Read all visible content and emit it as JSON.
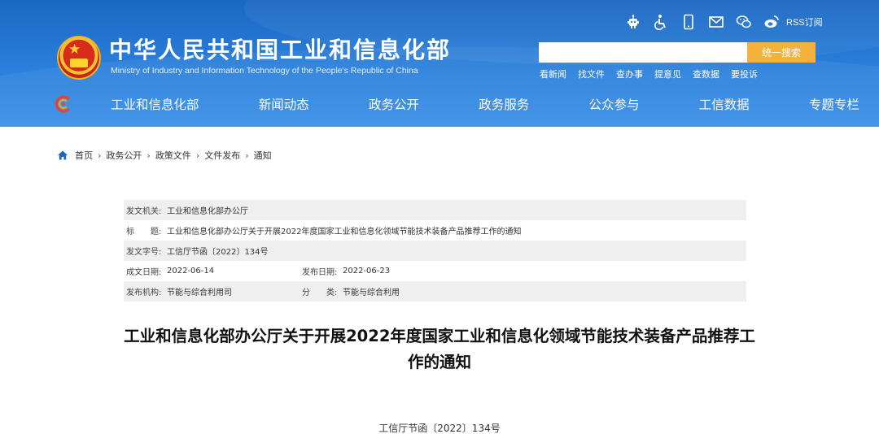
{
  "header": {
    "site_title": "中华人民共和国工业和信息化部",
    "site_subtitle": "Ministry of Industry and Information Technology of the People's Republic of China",
    "icons": [
      "robot-icon",
      "accessibility-icon",
      "mobile-icon",
      "mail-icon",
      "wechat-icon",
      "weibo-icon"
    ],
    "rss_label": "RSS订阅",
    "search": {
      "placeholder": "",
      "button_label": "统一搜索"
    },
    "quick_links": [
      "看新闻",
      "找文件",
      "查办事",
      "提意见",
      "查数据",
      "要投诉"
    ],
    "nav": [
      "工业和信息化部",
      "新闻动态",
      "政务公开",
      "政务服务",
      "公众参与",
      "工信数据",
      "专题专栏"
    ]
  },
  "breadcrumb": [
    "首页",
    "政务公开",
    "政策文件",
    "文件发布",
    "通知"
  ],
  "breadcrumb_sep": "›",
  "meta": {
    "issuer_label": "发文机关:",
    "issuer": "工业和信息化部办公厅",
    "title_label": "标　　题:",
    "title": "工业和信息化部办公厅关于开展2022年度国家工业和信息化领域节能技术装备产品推荐工作的通知",
    "doc_no_label": "发文字号:",
    "doc_no": "工信厅节函〔2022〕134号",
    "created_label": "成文日期:",
    "created": "2022-06-14",
    "published_label": "发布日期:",
    "published": "2022-06-23",
    "agency_label": "发布机构:",
    "agency": "节能与综合利用司",
    "category_label": "分　　类:",
    "category": "节能与综合利用"
  },
  "article": {
    "title": "工业和信息化部办公厅关于开展2022年度国家工业和信息化领域节能技术装备产品推荐工作的通知",
    "doc_no": "工信厅节函〔2022〕134号"
  },
  "colors": {
    "header_blue": "#2a80dc",
    "search_button": "#f3b23b",
    "meta_row_gray": "#efefef"
  }
}
